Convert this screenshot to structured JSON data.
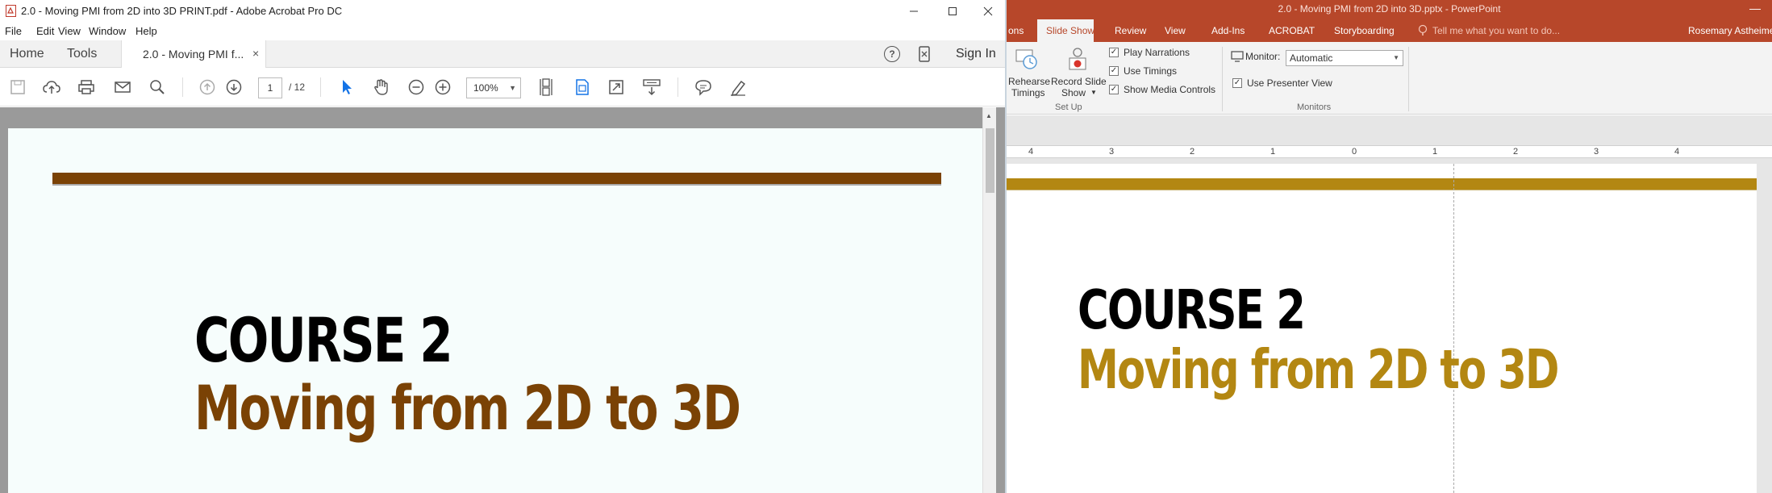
{
  "acrobat": {
    "window_title": "2.0 - Moving PMI from 2D into 3D PRINT.pdf - Adobe Acrobat Pro DC",
    "menu": [
      "File",
      "Edit",
      "View",
      "Window",
      "Help"
    ],
    "nav": {
      "home": "Home",
      "tools": "Tools"
    },
    "doc_tab": "2.0 - Moving PMI f...",
    "doc_tab_close": "×",
    "help_glyph": "?",
    "sign_in": "Sign In",
    "page_current": "1",
    "page_total": "/ 12",
    "zoom": "100%",
    "slide": {
      "line1": "COURSE 2",
      "line2": "Moving from 2D to 3D",
      "accent_color": "#7a4205"
    }
  },
  "powerpoint": {
    "window_title": "2.0 - Moving PMI from 2D into 3D.pptx - PowerPoint",
    "tabs": [
      "ons",
      "Slide Show",
      "Review",
      "View",
      "Add-Ins",
      "ACROBAT",
      "Storyboarding"
    ],
    "tell_me": "Tell me what you want to do...",
    "user": "Rosemary Astheimer",
    "ribbon": {
      "rehearse_line1": "Rehearse",
      "rehearse_line2": "Timings",
      "record_line1": "Record Slide",
      "record_line2": "Show",
      "play_narrations": "Play Narrations",
      "use_timings": "Use Timings",
      "show_media_controls": "Show Media Controls",
      "setup_group": "Set Up",
      "monitor_label": "Monitor:",
      "monitor_value": "Automatic",
      "use_presenter_view": "Use Presenter View",
      "monitors_group": "Monitors",
      "check": "✓"
    },
    "ruler": [
      "4",
      "3",
      "2",
      "1",
      "0",
      "1",
      "2",
      "3",
      "4"
    ],
    "slide": {
      "line1": "COURSE 2",
      "line2": "Moving from 2D to 3D",
      "accent_color": "#b38712"
    }
  }
}
